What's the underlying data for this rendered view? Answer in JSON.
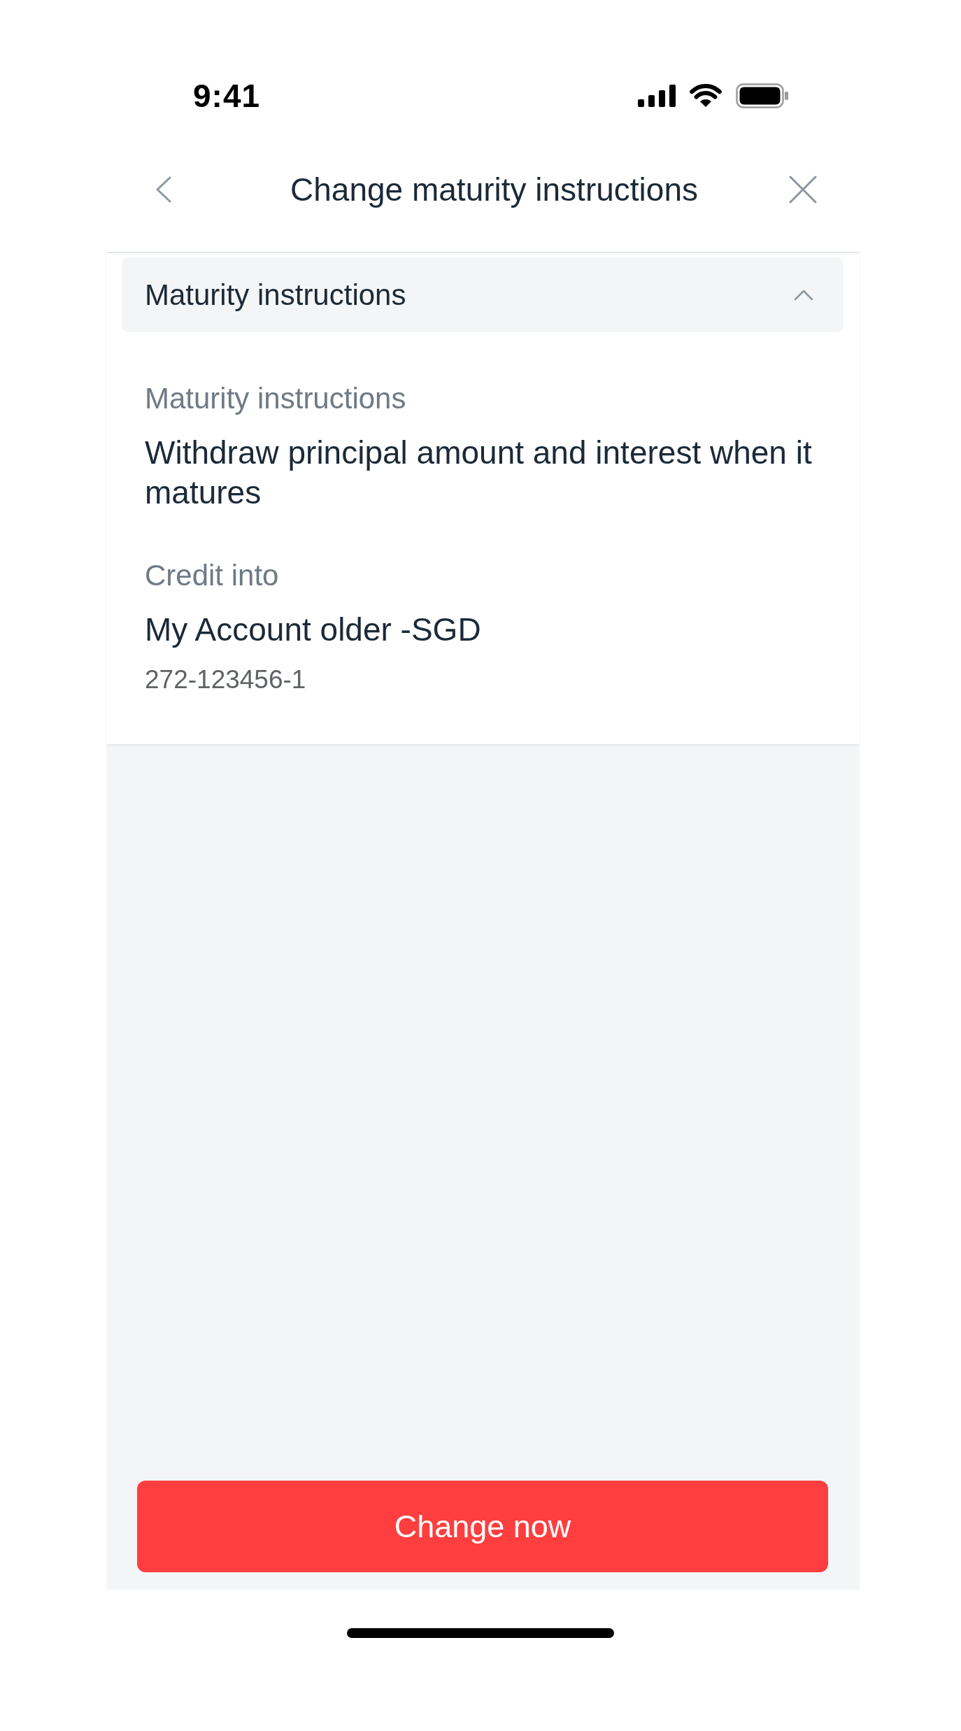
{
  "status_bar": {
    "time": "9:41"
  },
  "nav": {
    "title": "Change maturity instructions"
  },
  "section": {
    "title": "Maturity instructions",
    "expanded": true
  },
  "fields": [
    {
      "label": "Maturity instructions",
      "value": "Withdraw principal amount and interest when it matures"
    },
    {
      "label": "Credit into",
      "value": "My Account older -SGD",
      "account_number": "272-123456-1"
    }
  ],
  "primary_button": {
    "label": "Change now"
  }
}
